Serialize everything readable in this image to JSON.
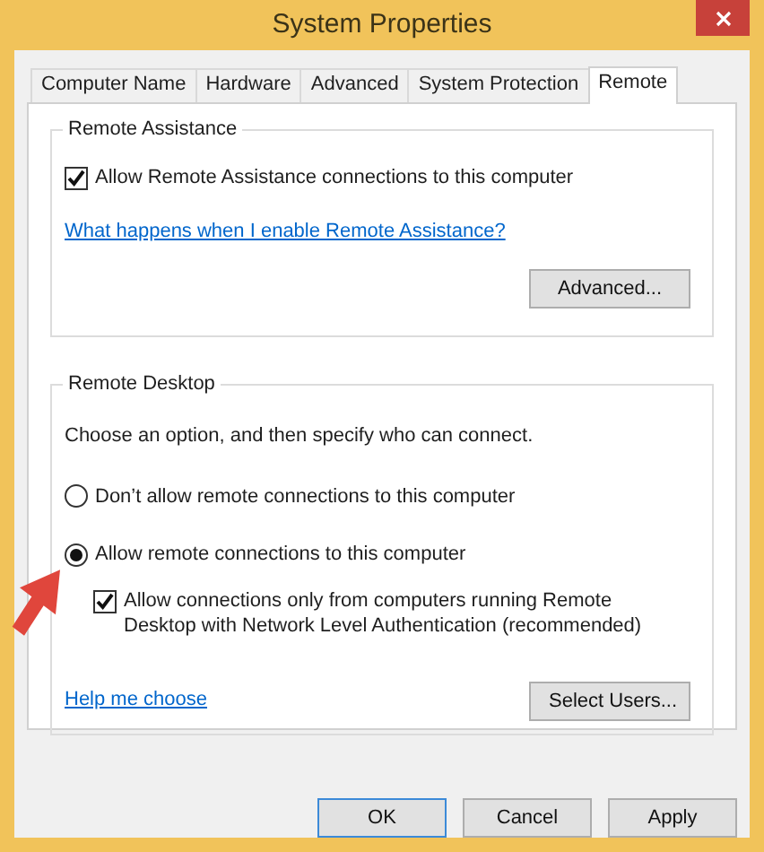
{
  "window": {
    "title": "System Properties"
  },
  "tabs": [
    {
      "label": "Computer Name",
      "selected": false
    },
    {
      "label": "Hardware",
      "selected": false
    },
    {
      "label": "Advanced",
      "selected": false
    },
    {
      "label": "System Protection",
      "selected": false
    },
    {
      "label": "Remote",
      "selected": true
    }
  ],
  "remote_assistance": {
    "title": "Remote Assistance",
    "checkbox": {
      "label": "Allow Remote Assistance connections to this computer",
      "checked": true
    },
    "link": "What happens when I enable Remote Assistance?",
    "button": "Advanced..."
  },
  "remote_desktop": {
    "title": "Remote Desktop",
    "instruction": "Choose an option, and then specify who can connect.",
    "options": [
      {
        "label": "Don’t allow remote connections to this computer",
        "selected": false
      },
      {
        "label": "Allow remote connections to this computer",
        "selected": true
      }
    ],
    "nla_checkbox": {
      "label": "Allow connections only from computers running Remote Desktop with Network Level Authentication (recommended)",
      "checked": true
    },
    "link": "Help me choose",
    "button": "Select Users..."
  },
  "buttons": [
    {
      "label": "OK",
      "focused": true
    },
    {
      "label": "Cancel",
      "focused": false
    },
    {
      "label": "Apply",
      "focused": false
    }
  ]
}
